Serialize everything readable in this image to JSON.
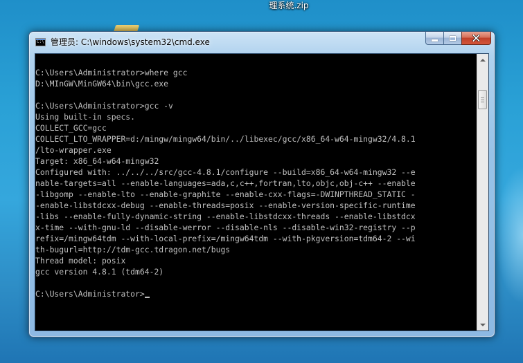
{
  "desktop": {
    "file_label": "理系统.zip"
  },
  "window": {
    "title": "管理员: C:\\windows\\system32\\cmd.exe",
    "icon": "cmd-icon",
    "icon_text": "C:\\"
  },
  "console": {
    "lines": [
      "C:\\Users\\Administrator>where gcc",
      "D:\\MInGW\\MinGW64\\bin\\gcc.exe",
      "",
      "C:\\Users\\Administrator>gcc -v",
      "Using built-in specs.",
      "COLLECT_GCC=gcc",
      "COLLECT_LTO_WRAPPER=d:/mingw/mingw64/bin/../libexec/gcc/x86_64-w64-mingw32/4.8.1",
      "/lto-wrapper.exe",
      "Target: x86_64-w64-mingw32",
      "Configured with: ../../../src/gcc-4.8.1/configure --build=x86_64-w64-mingw32 --e",
      "nable-targets=all --enable-languages=ada,c,c++,fortran,lto,objc,obj-c++ --enable",
      "-libgomp --enable-lto --enable-graphite --enable-cxx-flags=-DWINPTHREAD_STATIC -",
      "-enable-libstdcxx-debug --enable-threads=posix --enable-version-specific-runtime",
      "-libs --enable-fully-dynamic-string --enable-libstdcxx-threads --enable-libstdcx",
      "x-time --with-gnu-ld --disable-werror --disable-nls --disable-win32-registry --p",
      "refix=/mingw64tdm --with-local-prefix=/mingw64tdm --with-pkgversion=tdm64-2 --wi",
      "th-bugurl=http://tdm-gcc.tdragon.net/bugs",
      "Thread model: posix",
      "gcc version 4.8.1 (tdm64-2)",
      "",
      "C:\\Users\\Administrator>"
    ]
  },
  "colors": {
    "console_bg": "#000000",
    "console_fg": "#c0c0c0",
    "close_button": "#c7432c"
  }
}
